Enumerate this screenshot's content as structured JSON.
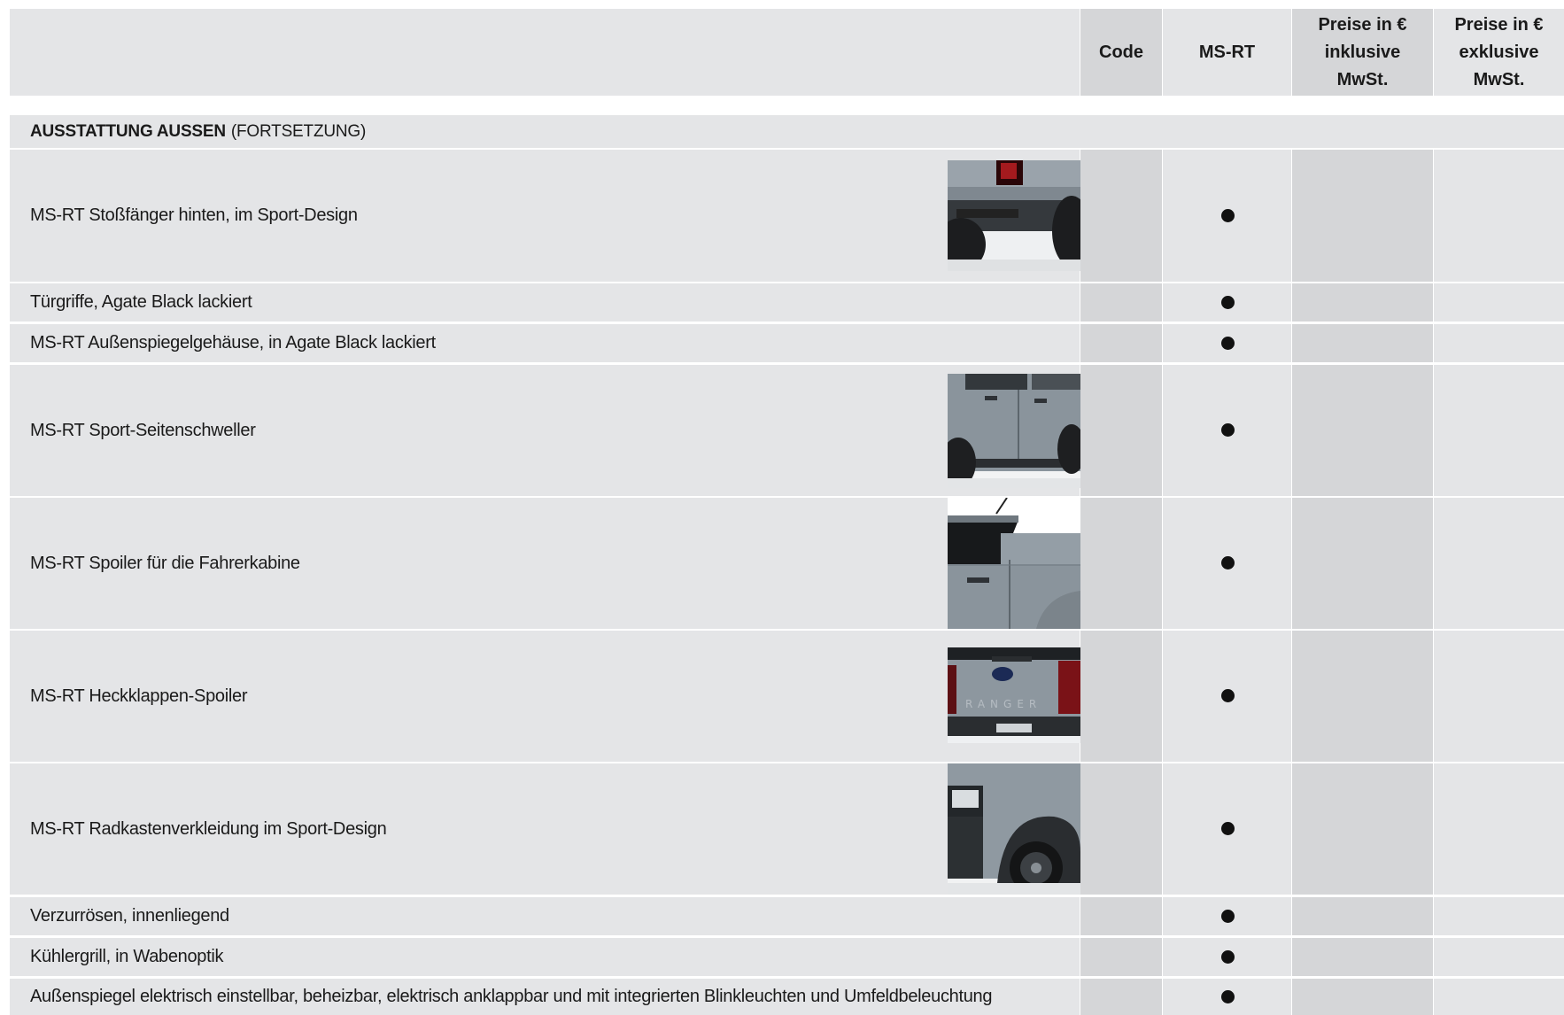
{
  "header": {
    "code": "Code",
    "ms_rt": "MS-RT",
    "price_incl": "Preise in € inklusive MwSt.",
    "price_excl": "Preise in € exklusive MwSt."
  },
  "section": {
    "title": "AUSSTATTUNG AUSSEN",
    "subtitle": "(FORTSETZUNG)"
  },
  "rows": [
    {
      "label": "MS-RT Stoßfänger hinten, im Sport-Design",
      "ms_rt": "●",
      "image": "rear-bumper-photo"
    },
    {
      "label": "Türgriffe, Agate Black lackiert",
      "ms_rt": "●"
    },
    {
      "label": "MS-RT Außenspiegelgehäuse, in Agate Black lackiert",
      "ms_rt": "●"
    },
    {
      "label": "MS-RT Sport-Seitenschweller",
      "ms_rt": "●",
      "image": "side-skirt-photo"
    },
    {
      "label": "MS-RT Spoiler für die Fahrerkabine",
      "ms_rt": "●",
      "image": "cab-spoiler-photo"
    },
    {
      "label": "MS-RT Heckklappen-Spoiler",
      "ms_rt": "●",
      "image": "tailgate-spoiler-photo"
    },
    {
      "label": "MS-RT Radkastenverkleidung im Sport-Design",
      "ms_rt": "●",
      "image": "wheel-arch-photo"
    },
    {
      "label": "Verzurrösen, innenliegend",
      "ms_rt": "●"
    },
    {
      "label": "Kühlergrill, in Wabenoptik",
      "ms_rt": "●"
    },
    {
      "label": "Außenspiegel elektrisch einstellbar, beheizbar, elektrisch anklappbar und mit integrierten Blinkleuchten und Umfeldbeleuchtung",
      "ms_rt": "●"
    }
  ],
  "colors": {
    "light_gray": "#e4e5e7",
    "mid_gray": "#d5d6d8",
    "bullet": "#111111"
  }
}
